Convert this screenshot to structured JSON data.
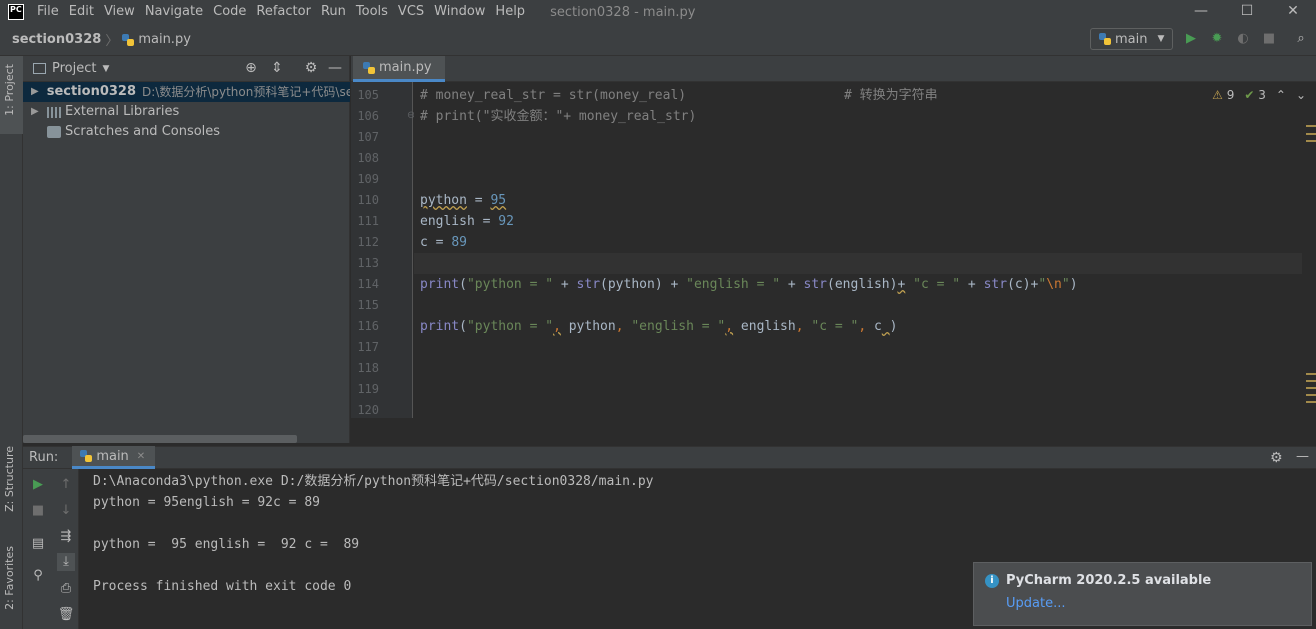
{
  "app": {
    "logo_text": "PC",
    "window_title": "section0328 - main.py",
    "menu": [
      "File",
      "Edit",
      "View",
      "Navigate",
      "Code",
      "Refactor",
      "Run",
      "Tools",
      "VCS",
      "Window",
      "Help"
    ],
    "minimize_glyph": "—",
    "maximize_glyph": "☐",
    "close_glyph": "✕"
  },
  "navbar": {
    "project": "section0328",
    "file": "main.py",
    "run_config": "main"
  },
  "left_strip": {
    "project_tab": "1: Project",
    "structure_tab": "Z: Structure",
    "favorites_tab": "2: Favorites"
  },
  "project_panel": {
    "title": "Project",
    "tree": [
      {
        "name": "section0328",
        "path": "D:\\数据分析\\python预科笔记+代码\\se"
      },
      {
        "name": "External Libraries"
      },
      {
        "name": "Scratches and Consoles"
      }
    ]
  },
  "editor": {
    "tab": "main.py",
    "warnings_count": "9",
    "weak_warnings_count": "3",
    "line_numbers": [
      "105",
      "106",
      "107",
      "108",
      "109",
      "110",
      "111",
      "112",
      "113",
      "114",
      "115",
      "116",
      "117",
      "118",
      "119",
      "120"
    ],
    "lines": {
      "l105_code": "# money_real_str = str(money_real)",
      "l105_comment": "# 转换为字符串",
      "l106": "# print(\"实收金额：\"+ money_real_str)",
      "l110_var": "python",
      "l110_op": " = ",
      "l110_num": "95",
      "l111_var": "english",
      "l111_op": " = ",
      "l111_num": "92",
      "l112_var": "c",
      "l112_op": " = ",
      "l112_num": "89",
      "l114": {
        "fn1": "print",
        "p1": "(",
        "s1": "\"python = \"",
        "a1": " + ",
        "fn2": "str",
        "a2": "(python) + ",
        "s2": "\"english = \"",
        "a3": " + ",
        "fn3": "str",
        "a4": "(english)",
        "a5": "+",
        "a6": " ",
        "s3": "\"c = \"",
        "a7": " + ",
        "fn4": "str",
        "a8": "(c)+",
        "s4": "\"",
        "esc": "\\n",
        "s5": "\"",
        "p2": ")"
      },
      "l116": {
        "fn1": "print",
        "p1": "(",
        "s1": "\"python = \"",
        "c1": ",",
        "a1": " python",
        "c2": ",",
        "a2": " ",
        "s2": "\"english = \"",
        "c3": ",",
        "a3": " english",
        "c4": ",",
        "a4": " ",
        "s3": "\"c = \"",
        "c5": ",",
        "a5": " c",
        "c6": " ",
        "p2": ")"
      }
    }
  },
  "run_panel": {
    "label": "Run:",
    "tab": "main",
    "output": [
      "D:\\Anaconda3\\python.exe D:/数据分析/python预科笔记+代码/section0328/main.py",
      "python = 95english = 92c = 89",
      "",
      "python =  95 english =  92 c =  89",
      "",
      "Process finished with exit code 0"
    ]
  },
  "notification": {
    "icon": "i",
    "title": "PyCharm 2020.2.5 available",
    "link": "Update..."
  }
}
